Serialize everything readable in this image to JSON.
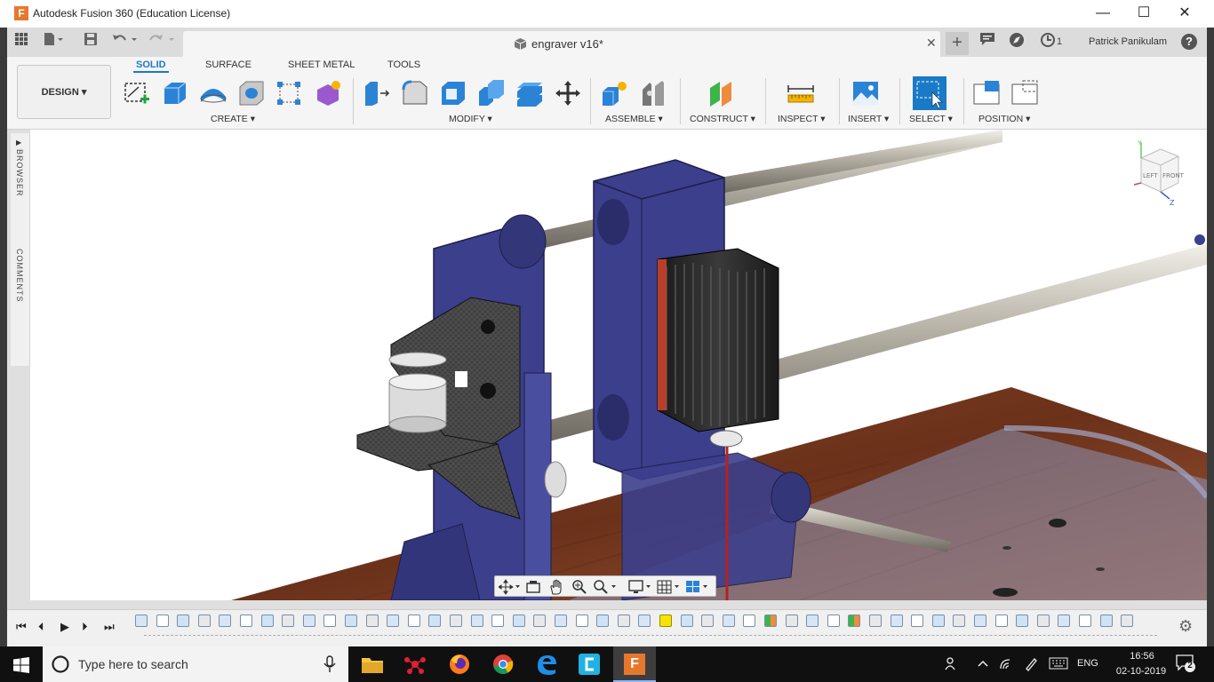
{
  "window": {
    "title": "Autodesk Fusion 360 (Education License)",
    "logo_letter": "F",
    "minimize": "—",
    "maximize": "☐",
    "close": "✕"
  },
  "tabbar": {
    "document_title": "engraver v16*",
    "close_tab": "✕",
    "add_tab": "+",
    "job_count": "1",
    "user_name": "Patrick Panikulam",
    "help": "?"
  },
  "toolbar": {
    "workspace": "DESIGN ▾",
    "tabs": [
      "SOLID",
      "SURFACE",
      "SHEET METAL",
      "TOOLS"
    ],
    "groups": {
      "create": "CREATE ▾",
      "modify": "MODIFY ▾",
      "assemble": "ASSEMBLE ▾",
      "construct": "CONSTRUCT ▾",
      "inspect": "INSPECT ▾",
      "insert": "INSERT ▾",
      "select": "SELECT ▾",
      "position": "POSITION ▾"
    }
  },
  "side_panel": {
    "browser": "BROWSER",
    "comments": "COMMENTS"
  },
  "viewcube": {
    "left": "LEFT",
    "front": "FRONT",
    "y_axis": "Y",
    "z_axis": "Z"
  },
  "timeline": {
    "first": "⏮",
    "prev": "⏴",
    "play": "▶",
    "next": "⏵",
    "last": "⏭",
    "settings": "⚙"
  },
  "taskbar": {
    "search_placeholder": "Type here to search",
    "language": "ENG",
    "time": "16:56",
    "date": "02-10-2019",
    "notification_count": "2"
  },
  "colors": {
    "accent": "#1a7ac7",
    "part_blue": "#3c3f8c",
    "wood": "#7a3a22",
    "fusion_orange": "#e8772e"
  }
}
